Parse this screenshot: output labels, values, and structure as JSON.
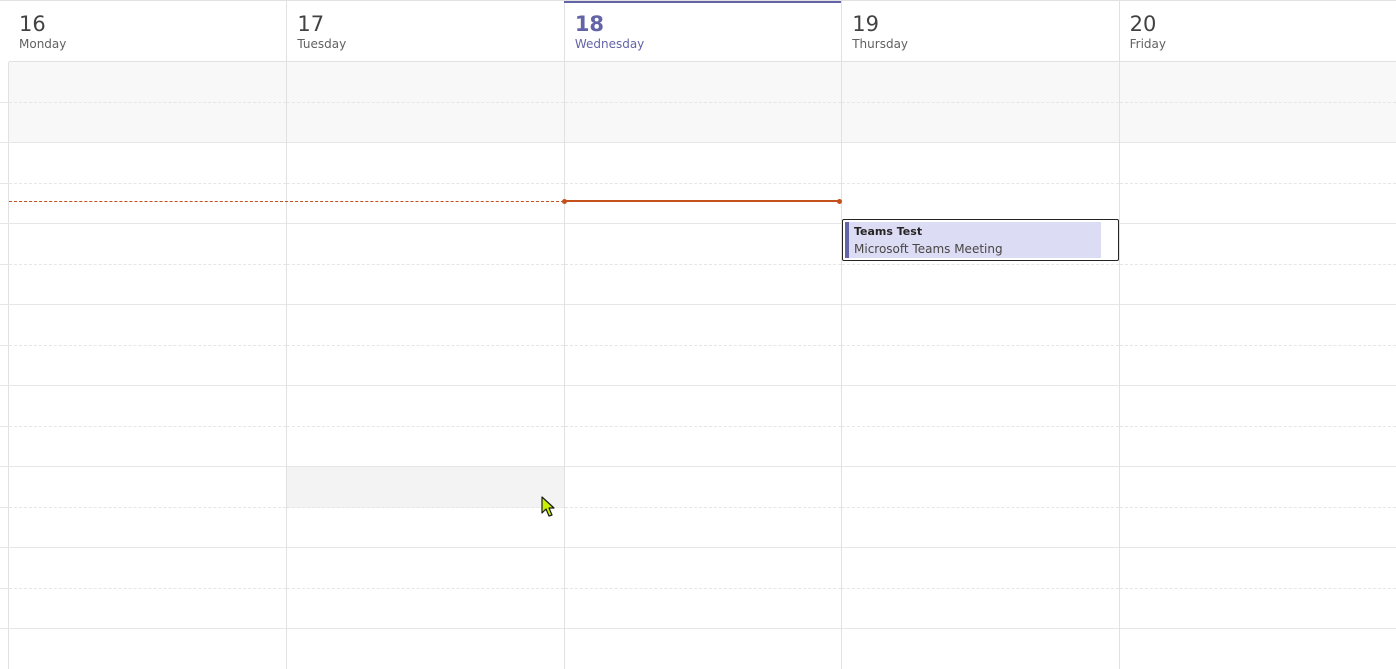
{
  "calendar": {
    "days": [
      {
        "num": "16",
        "name": "Monday"
      },
      {
        "num": "17",
        "name": "Tuesday"
      },
      {
        "num": "18",
        "name": "Wednesday"
      },
      {
        "num": "19",
        "name": "Thursday"
      },
      {
        "num": "20",
        "name": "Friday"
      }
    ],
    "today_index": 2
  },
  "event": {
    "title": "Teams Test",
    "subtitle": "Microsoft Teams Meeting"
  },
  "colors": {
    "accent": "#6264a7",
    "now_line": "#c4501b",
    "event_fill": "#dcdcf5"
  },
  "icons": {
    "cursor": "arrow-cursor-icon"
  }
}
